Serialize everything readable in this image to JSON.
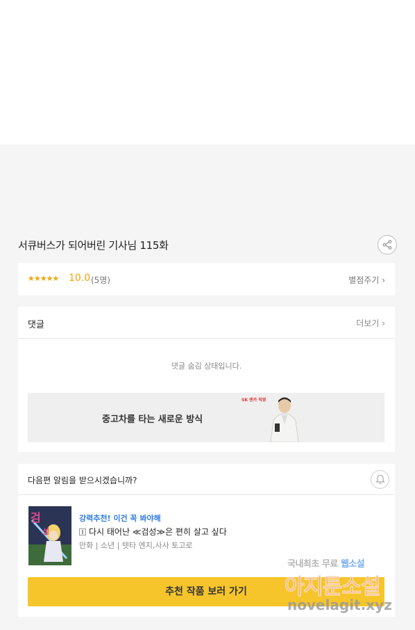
{
  "episode": {
    "title": "서큐버스가 되어버린 기사님 115화"
  },
  "rating": {
    "stars": "★★★★★",
    "score": "10.0",
    "voters": "(5명)",
    "rate_link": "별점주기",
    "star_color": "#f0a30a"
  },
  "comments": {
    "header": "댓글",
    "more_link": "더보기",
    "hidden_message": "댓글 숨김 상태입니다."
  },
  "ad": {
    "text": "중고차를 타는 새로운 방식",
    "logo_text": "SK 엔카 직영"
  },
  "notify": {
    "question": "다음편 알림을 받으시겠습니까?"
  },
  "recommend": {
    "tag": "강력추천! 이건 꼭 봐야해",
    "title": "다시 태어난 ≪검성≫은 편히 살고 싶다",
    "meta": "만화 | 소년 | 텟타 엔지,사사 토고로",
    "button_label": "추천 작품 보러 가기",
    "tag_color": "#2f7de1",
    "button_color": "#f6c52b"
  },
  "watermark": {
    "line1_prefix": "국내최초 무료",
    "line1_highlight": "웹소설",
    "line2": "아지툰소설",
    "line3": "novelagit.xyz"
  }
}
